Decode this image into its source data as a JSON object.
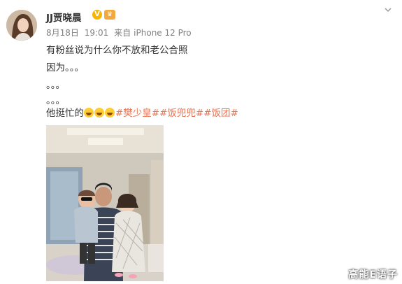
{
  "post": {
    "username": "JJ贾晓晨",
    "verified_icon": "verified-v-icon",
    "member_icon": "member-crown-icon",
    "date": "8月18日",
    "time": "19:01",
    "source_prefix": "来自",
    "source": "iPhone 12 Pro",
    "lines": {
      "line1": "有粉丝说为什么你不放和老公合照",
      "line2": "因为。。。",
      "line3": "。。。",
      "line4": "。。。",
      "line5_text": "他挺忙的"
    },
    "emoji_name": "laugh-cry-emoji",
    "hashtags": [
      "#樊少皇#",
      "#饭兜兜#",
      "#饭团#"
    ]
  },
  "watermark": "高能E语子",
  "colors": {
    "hashtag": "#eb7350",
    "verified": "#f7b500",
    "meta": "#808080"
  }
}
